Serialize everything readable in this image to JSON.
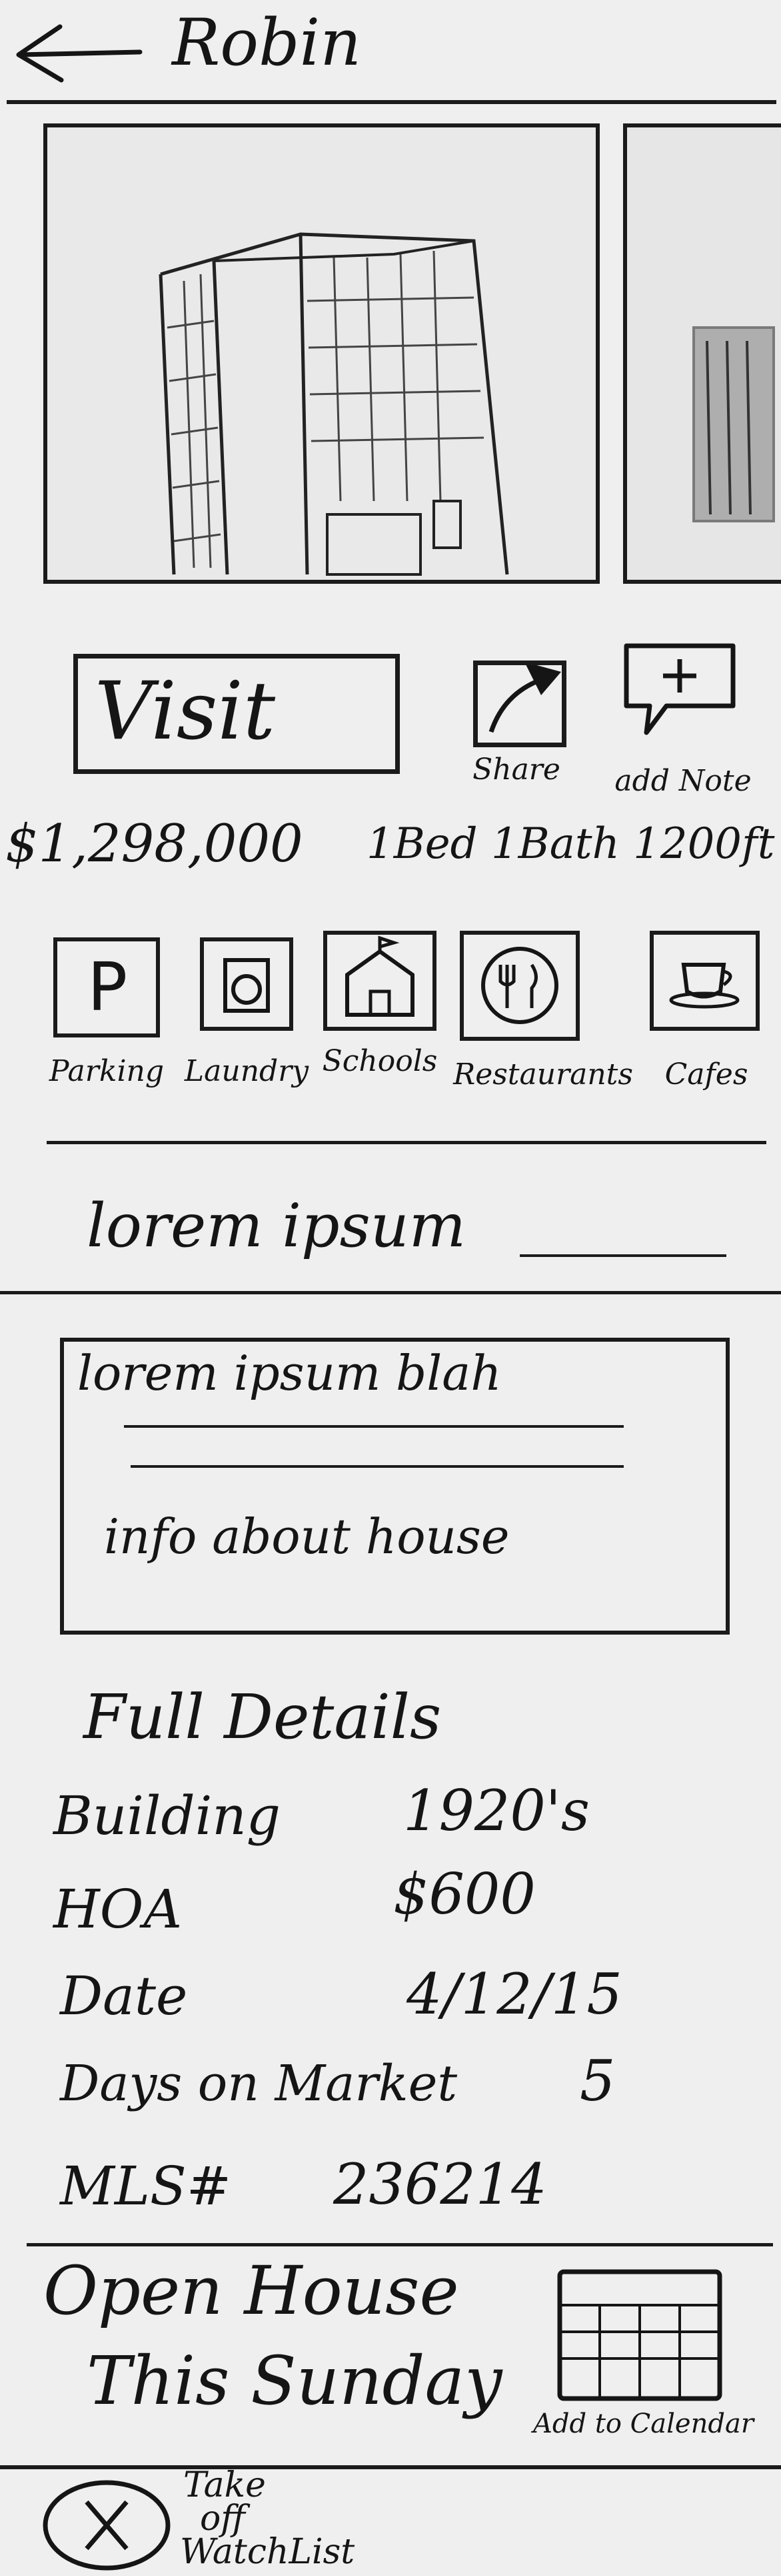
{
  "header": {
    "title": "Robin",
    "back_icon": "arrow-left-icon"
  },
  "actions": {
    "visit_label": "Visit",
    "share_label": "Share",
    "add_note_label": "add Note"
  },
  "listing": {
    "price": "$1,298,000",
    "summary": "1Bed 1Bath 1200ft"
  },
  "amenities": [
    {
      "label": "Parking",
      "icon": "parking-icon"
    },
    {
      "label": "Laundry",
      "icon": "laundry-icon"
    },
    {
      "label": "Schools",
      "icon": "school-icon"
    },
    {
      "label": "Restaurants",
      "icon": "restaurant-icon"
    },
    {
      "label": "Cafes",
      "icon": "cafe-icon"
    }
  ],
  "description": {
    "heading": "lorem ipsum",
    "line1": "lorem ipsum blah",
    "line2": "info about house"
  },
  "details": {
    "title": "Full Details",
    "rows": [
      {
        "label": "Building",
        "value": "1920's"
      },
      {
        "label": "HOA",
        "value": "$600"
      },
      {
        "label": "Date",
        "value": "4/12/15"
      },
      {
        "label": "Days on Market",
        "value": "5"
      },
      {
        "label": "MLS#",
        "value": "236214"
      }
    ]
  },
  "open_house": {
    "line1": "Open House",
    "line2": "This Sunday",
    "calendar_label": "Add to Calendar"
  },
  "watchlist": {
    "line1": "Take",
    "line2": "off",
    "line3": "WatchList"
  }
}
